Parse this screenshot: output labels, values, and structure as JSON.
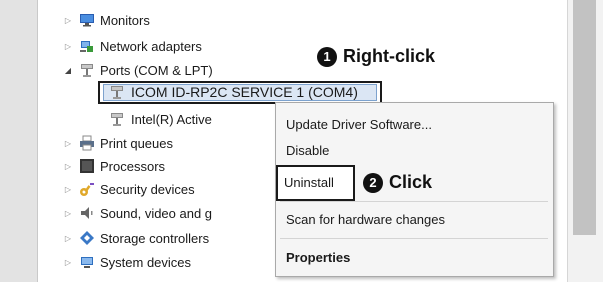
{
  "tree": {
    "items": [
      {
        "label": "Monitors",
        "icon": "monitor-icon"
      },
      {
        "label": "Network adapters",
        "icon": "network-adapter-icon"
      },
      {
        "label": "Ports (COM & LPT)",
        "icon": "port-icon"
      },
      {
        "label": "ICOM ID-RP2C SERVICE 1 (COM4)",
        "icon": "port-icon"
      },
      {
        "label": "Intel(R) Active",
        "icon": "port-icon"
      },
      {
        "label": "Print queues",
        "icon": "printer-icon"
      },
      {
        "label": "Processors",
        "icon": "processor-icon"
      },
      {
        "label": "Security devices",
        "icon": "key-icon"
      },
      {
        "label": "Sound, video and g",
        "icon": "speaker-icon"
      },
      {
        "label": "Storage controllers",
        "icon": "storage-icon"
      },
      {
        "label": "System devices",
        "icon": "system-icon"
      }
    ]
  },
  "callouts": {
    "step1_number": "1",
    "step1_text": "Right-click",
    "step2_number": "2",
    "step2_text": "Click"
  },
  "context_menu": {
    "update_driver": "Update Driver Software...",
    "disable": "Disable",
    "uninstall": "Uninstall",
    "scan": "Scan for hardware changes",
    "properties": "Properties"
  }
}
